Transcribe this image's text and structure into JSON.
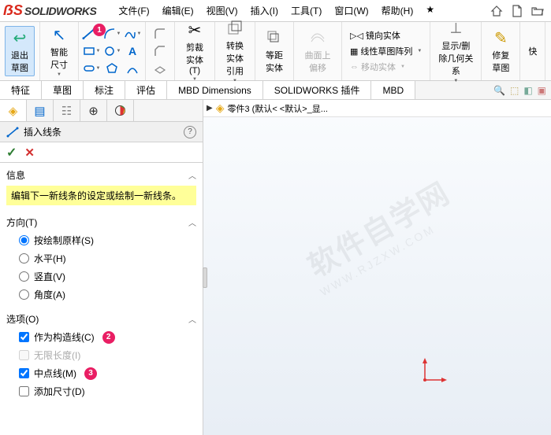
{
  "app": {
    "name": "SOLIDWORKS"
  },
  "menu": [
    "文件(F)",
    "编辑(E)",
    "视图(V)",
    "插入(I)",
    "工具(T)",
    "窗口(W)",
    "帮助(H)"
  ],
  "ribbon": {
    "exit_sketch": "退出草图",
    "smart_dim": "智能尺寸",
    "trim": "剪裁实体(T)",
    "convert": "转换实体引用",
    "offset": "等距实体",
    "surface_offset": "曲面上偏移",
    "mirror": "镜向实体",
    "pattern": "线性草图阵列",
    "move": "移动实体",
    "show_rel": "显示/删除几何关系",
    "repair": "修复草图",
    "quick": "快"
  },
  "tabs": [
    "特征",
    "草图",
    "标注",
    "评估",
    "MBD Dimensions",
    "SOLIDWORKS 插件",
    "MBD"
  ],
  "panel": {
    "cmd_title": "插入线条",
    "info_head": "信息",
    "info_msg": "编辑下一新线条的设定或绘制一新线条。",
    "dir_head": "方向(T)",
    "dir_opts": {
      "as_sketched": "按绘制原样(S)",
      "horizontal": "水平(H)",
      "vertical": "竖直(V)",
      "angle": "角度(A)"
    },
    "opt_head": "选项(O)",
    "opts": {
      "construction": "作为构造线(C)",
      "infinite": "无限长度(I)",
      "midpoint": "中点线(M)",
      "add_dim": "添加尺寸(D)"
    }
  },
  "viewport": {
    "part_label": "零件3  (默认< <默认>_显..."
  },
  "badges": {
    "b1": "1",
    "b2": "2",
    "b3": "3"
  },
  "watermark": {
    "main": "软件自学网",
    "sub": "WWW.RJZXW.COM"
  }
}
